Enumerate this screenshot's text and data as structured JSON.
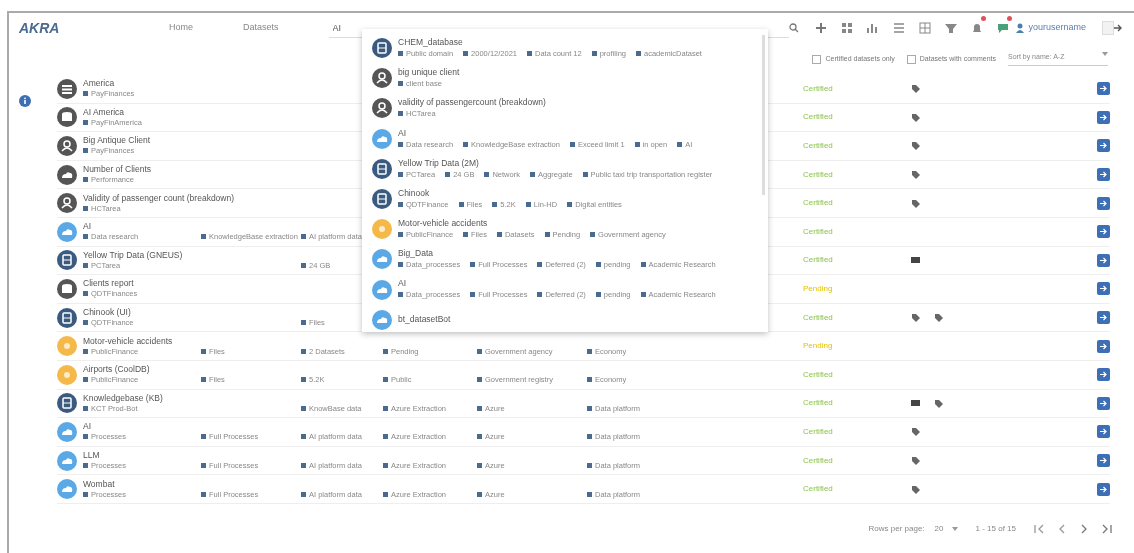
{
  "header": {
    "logo": "AKRA",
    "nav": [
      {
        "label": "Home",
        "selected": false
      },
      {
        "label": "Datasets",
        "selected": false
      }
    ],
    "search": {
      "value": "AI"
    },
    "user": "yourusername",
    "toolbar": [
      {
        "kind": "plus",
        "alert": false
      },
      {
        "kind": "grid",
        "alert": false
      },
      {
        "kind": "chart",
        "alert": false
      },
      {
        "kind": "list",
        "alert": false
      },
      {
        "kind": "table",
        "alert": false
      },
      {
        "kind": "filter",
        "alert": false
      },
      {
        "kind": "bell",
        "alert": true
      },
      {
        "kind": "chat",
        "alert": true
      }
    ]
  },
  "filters": {
    "checks": [
      {
        "label": "Certified datasets only",
        "checked": false
      },
      {
        "label": "Datasets with comments",
        "checked": false
      }
    ],
    "sort": "Sort by name: A-Z"
  },
  "rows": [
    {
      "title": "America",
      "kind": "db",
      "fields": {
        "owner": "PayFinances"
      },
      "status": {
        "text": "Certified",
        "kind": "certified"
      },
      "actions": [
        {
          "kind": "tag"
        }
      ]
    },
    {
      "title": "AI America",
      "kind": "cylinder",
      "fields": {
        "owner": "PayFinAmerica"
      },
      "status": {
        "text": "Certified",
        "kind": "certified"
      },
      "actions": [
        {
          "kind": "tag"
        }
      ]
    },
    {
      "title": "Big Antique Client",
      "kind": "person",
      "fields": {
        "owner": "PayFinances"
      },
      "status": {
        "text": "Certified",
        "kind": "certified"
      },
      "actions": [
        {
          "kind": "tag"
        }
      ]
    },
    {
      "title": "Number of Clients",
      "kind": "cloud",
      "fields": {
        "owner": "Performance"
      },
      "status": {
        "text": "Certified",
        "kind": "certified"
      },
      "actions": [
        {
          "kind": "tag"
        }
      ]
    },
    {
      "title": "Validity of passenger count (breakdown)",
      "kind": "person",
      "fields": {
        "owner": "HCTarea"
      },
      "status": {
        "text": "Certified",
        "kind": "certified"
      },
      "actions": [
        {
          "kind": "tag"
        }
      ]
    },
    {
      "title": "AI",
      "kind": "cloud-blue",
      "fields": {
        "owner": "Data research",
        "size": "KnowledgeBase extraction",
        "updated": "AI platform data"
      },
      "status": {
        "text": "Certified",
        "kind": "certified"
      }
    },
    {
      "title": "Yellow Trip Data (GNEUS)",
      "kind": "db-navy",
      "fields": {
        "owner": "PCTarea",
        "updated": "24 GB"
      },
      "status": {
        "text": "Certified",
        "kind": "certified"
      },
      "actions": [
        {
          "kind": "comment"
        }
      ]
    },
    {
      "title": "Clients report",
      "kind": "cylinder",
      "fields": {
        "owner": "QDTFinances"
      },
      "status": {
        "text": "Pending",
        "kind": "pending"
      }
    },
    {
      "title": "Chinook (UI)",
      "kind": "db-navy",
      "fields": {
        "owner": "QDTFinance",
        "updated": "Files"
      },
      "status": {
        "text": "Certified",
        "kind": "certified"
      },
      "actions": [
        {
          "kind": "tag"
        },
        {
          "kind": "tag"
        }
      ]
    },
    {
      "title": "Motor-vehicle accidents",
      "kind": "orange",
      "fields": {
        "owner": "PublicFinance",
        "size": "Files",
        "updated": "2 Datasets",
        "type": "Pending",
        "source": "Government agency",
        "category": "Economy"
      },
      "status": {
        "text": "Pending",
        "kind": "pending"
      }
    },
    {
      "title": "Airports (CoolDB)",
      "kind": "orange",
      "fields": {
        "owner": "PublicFinance",
        "size": "Files",
        "updated": "5.2K",
        "type": "Public",
        "source": "Government registry",
        "category": "Economy"
      },
      "status": {
        "text": "Certified",
        "kind": "certified"
      }
    },
    {
      "title": "Knowledgebase (KB)",
      "kind": "db-navy",
      "fields": {
        "owner": "KCT Prod-Bot",
        "updated": "KnowBase data",
        "type": "Azure Extraction",
        "source": "Azure",
        "category": "Data platform"
      },
      "status": {
        "text": "Certified",
        "kind": "certified"
      },
      "actions": [
        {
          "kind": "comment"
        },
        {
          "kind": "tag"
        }
      ]
    },
    {
      "title": "AI",
      "kind": "cloud-blue",
      "fields": {
        "owner": "Processes",
        "size": "Full Processes",
        "updated": "AI platform data",
        "type": "Azure Extraction",
        "source": "Azure",
        "category": "Data platform"
      },
      "status": {
        "text": "Certified",
        "kind": "certified"
      },
      "actions": [
        {
          "kind": "tag"
        }
      ]
    },
    {
      "title": "LLM",
      "kind": "cloud-blue",
      "fields": {
        "owner": "Processes",
        "size": "Full Processes",
        "updated": "AI platform data",
        "type": "Azure Extraction",
        "source": "Azure",
        "category": "Data platform"
      },
      "status": {
        "text": "Certified",
        "kind": "certified"
      },
      "actions": [
        {
          "kind": "tag"
        }
      ]
    },
    {
      "title": "Wombat",
      "kind": "cloud-blue",
      "fields": {
        "owner": "Processes",
        "size": "Full Processes",
        "updated": "AI platform data",
        "type": "Azure Extraction",
        "source": "Azure",
        "category": "Data platform"
      },
      "status": {
        "text": "Certified",
        "kind": "certified"
      },
      "actions": [
        {
          "kind": "tag"
        }
      ]
    }
  ],
  "suggestions": [
    {
      "title": "CHEM_database",
      "kind": "db-navy",
      "meta": [
        "Public domain",
        "2000/12/2021",
        "Data count 12",
        "profiling",
        "academicDataset"
      ]
    },
    {
      "title": "big unique client",
      "kind": "person",
      "meta": [
        "client base"
      ]
    },
    {
      "title": "validity of passengercount (breakdown)",
      "kind": "person",
      "meta": [
        "HCTarea"
      ]
    },
    {
      "title": "AI",
      "kind": "cloud-blue",
      "meta": [
        "Data research",
        "KnowledgeBase extraction",
        "Exceed limit 1",
        "in open",
        "AI"
      ]
    },
    {
      "title": "Yellow Trip Data (2M)",
      "kind": "db-navy",
      "meta": [
        "PCTarea",
        "24 GB",
        "Network",
        "Aggregate",
        "Public taxi trip transportation register"
      ]
    },
    {
      "title": "Chinook",
      "kind": "db-navy",
      "meta": [
        "QDTFinance",
        "Files",
        "5.2K",
        "Lin-HD",
        "Digital entities"
      ]
    },
    {
      "title": "Motor-vehicle accidents",
      "kind": "orange",
      "meta": [
        "PublicFinance",
        "Files",
        "Datasets",
        "Pending",
        "Government agency"
      ]
    },
    {
      "title": "Big_Data",
      "kind": "cloud-blue",
      "meta": [
        "Data_processes",
        "Full Processes",
        "Deferred (2)",
        "pending",
        "Academic Research"
      ]
    },
    {
      "title": "AI",
      "kind": "cloud-blue",
      "meta": [
        "Data_processes",
        "Full Processes",
        "Deferred (2)",
        "pending",
        "Academic Research"
      ]
    },
    {
      "title": "bt_datasetBot",
      "kind": "cloud-blue"
    }
  ],
  "pagination": {
    "rows_label": "Rows per page:",
    "rows_value": "20",
    "range": "1 - 15 of 15"
  }
}
